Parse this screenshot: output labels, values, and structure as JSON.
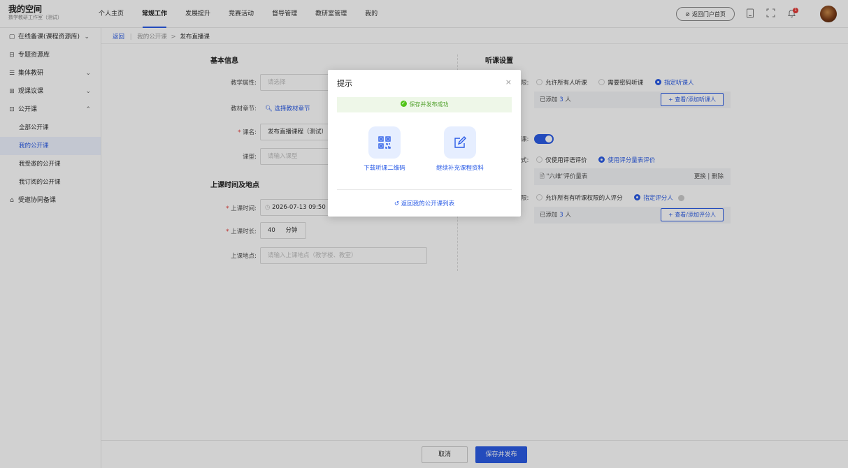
{
  "header": {
    "title": "我的空间",
    "subtitle": "数学教研工作室（测试）",
    "nav": [
      "个人主页",
      "常规工作",
      "发展提升",
      "竞赛活动",
      "督导管理",
      "教研室管理",
      "我的"
    ],
    "portal_label": "返回门户首页",
    "notification_badge": "1"
  },
  "sidebar": {
    "items": [
      {
        "label": "在线备课(课程资源库)",
        "icon": "document-icon",
        "chevron": "down"
      },
      {
        "label": "专题资源库",
        "icon": "folder-icon"
      },
      {
        "label": "集体教研",
        "icon": "list-icon",
        "chevron": "down"
      },
      {
        "label": "观课议课",
        "icon": "observe-icon",
        "chevron": "down"
      },
      {
        "label": "公开课",
        "icon": "screen-icon",
        "chevron": "up"
      }
    ],
    "subitems": [
      "全部公开课",
      "我的公开课",
      "我受邀的公开课",
      "我订阅的公开课"
    ],
    "active_subitem": "我的公开课",
    "last_item": {
      "label": "受邀协同备课",
      "icon": "team-icon"
    }
  },
  "breadcrumb": {
    "back": "返回",
    "sep": "|",
    "parent": "我的公开课",
    "arrow": ">",
    "current": "发布直播课"
  },
  "basic": {
    "title": "基本信息",
    "subject_label": "教学属性:",
    "subject_placeholder": "请选择",
    "chapter_label": "教材章节:",
    "chapter_link": "选择教材章节",
    "name_label": "课名:",
    "name_value": "发布直播课程（测试）",
    "type_label": "课型:",
    "type_placeholder": "请输入课型"
  },
  "schedule": {
    "title": "上课时间及地点",
    "time_label": "上课时间:",
    "time_value": "2026-07-13 09:50",
    "duration_label": "上课时长:",
    "duration_value": "40",
    "duration_unit": "分钟",
    "place_label": "上课地点:",
    "place_placeholder": "请输入上课地点（教学楼、教室）"
  },
  "listen": {
    "title": "听课设置",
    "perm_label_tail": "限:",
    "perm_options": [
      "允许所有人听课",
      "需要密码听课",
      "指定听课人"
    ],
    "perm_selected": "指定听课人",
    "added_prefix": "已添加",
    "added_count": "3",
    "added_suffix": "人",
    "add_listener_btn": "+ 查看/添加听课人",
    "eval_switch_label_tail": "课:",
    "eval_switch_on": true,
    "method_label_tail": "式:",
    "method_options": [
      "仅使用评语评价",
      "使用评分量表评价"
    ],
    "method_selected": "使用评分量表评价",
    "scale_name": "\"六维\"评价量表",
    "scale_actions": "更换 | 删除",
    "rater_label_tail": "限:",
    "rater_options": [
      "允许所有有听课权限的人评分",
      "指定评分人"
    ],
    "rater_selected": "指定评分人",
    "rater_added_prefix": "已添加",
    "rater_added_count": "3",
    "rater_added_suffix": "人",
    "add_rater_btn": "+ 查看/添加评分人"
  },
  "footer": {
    "cancel": "取消",
    "submit": "保存并发布"
  },
  "modal": {
    "title": "提示",
    "close": "×",
    "success_text": "保存并发布成功",
    "action_qr": "下载听课二维码",
    "action_more": "继续补充课程资料",
    "back_link": "返回我的公开课列表"
  },
  "colors": {
    "accent": "#2b5ce6",
    "success": "#52c41a",
    "danger": "#e53935"
  }
}
